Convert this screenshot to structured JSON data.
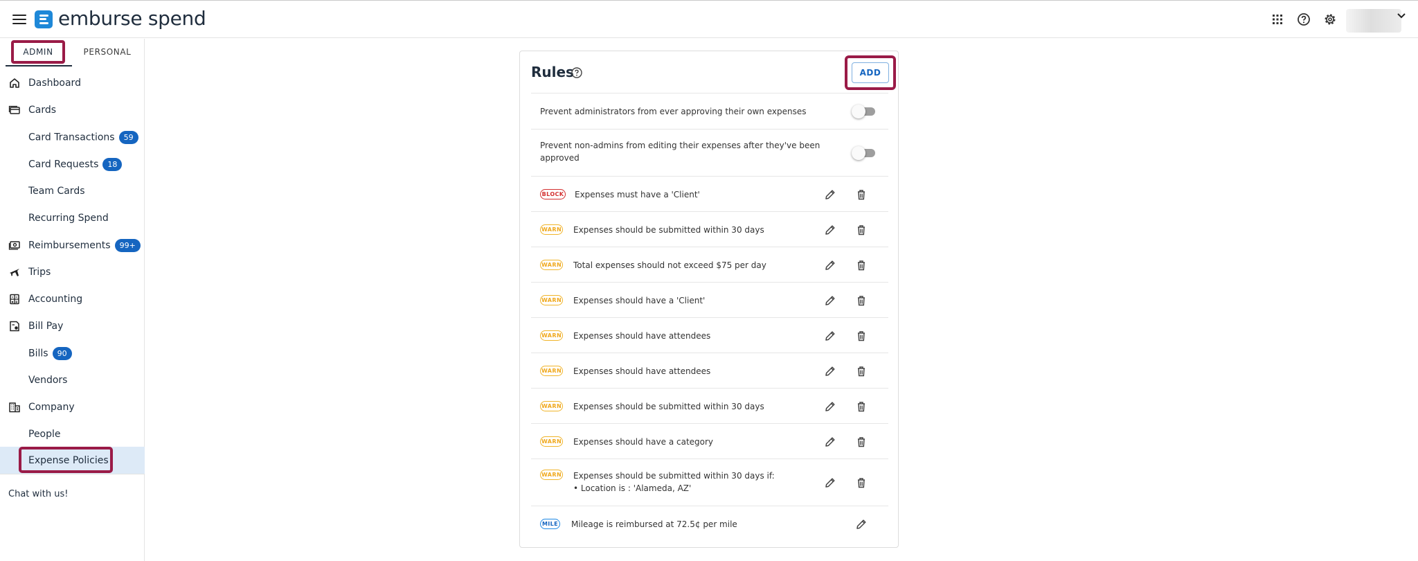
{
  "brand": {
    "name": "emburse spend",
    "color": "#1e88d8"
  },
  "highlight_color": "#9a1b47",
  "header": {
    "icons": [
      "apps-grid-icon",
      "help-circle-icon",
      "settings-gear-icon",
      "chevron-down-icon"
    ]
  },
  "sidebar": {
    "tabs": {
      "admin": "ADMIN",
      "personal": "PERSONAL"
    },
    "items": [
      {
        "label": "Dashboard",
        "icon": "home-icon"
      },
      {
        "label": "Cards",
        "icon": "cards-icon"
      },
      {
        "label": "Card Transactions",
        "badge": "59"
      },
      {
        "label": "Card Requests",
        "badge": "18"
      },
      {
        "label": "Team Cards"
      },
      {
        "label": "Recurring Spend"
      },
      {
        "label": "Reimbursements",
        "badge": "99+",
        "icon": "money-icon"
      },
      {
        "label": "Trips",
        "icon": "plane-icon"
      },
      {
        "label": "Accounting",
        "icon": "accounting-icon"
      },
      {
        "label": "Bill Pay",
        "icon": "bill-icon"
      },
      {
        "label": "Bills",
        "badge": "90"
      },
      {
        "label": "Vendors"
      },
      {
        "label": "Company",
        "icon": "building-icon"
      },
      {
        "label": "People"
      },
      {
        "label": "Expense Policies",
        "active": true
      }
    ],
    "chat": "Chat with us!"
  },
  "rules": {
    "title": "Rules",
    "add_label": "ADD",
    "toggles": [
      {
        "text": "Prevent administrators from ever approving their own expenses",
        "on": false
      },
      {
        "line1": "Prevent non-admins from editing their expenses after they've been",
        "line2": "approved",
        "on": false
      }
    ],
    "list": [
      {
        "tag": "BLOCK",
        "text": "Expenses must have a 'Client'"
      },
      {
        "tag": "WARN",
        "text": "Expenses should be submitted within 30 days"
      },
      {
        "tag": "WARN",
        "text": "Total expenses should not exceed $75 per day"
      },
      {
        "tag": "WARN",
        "text": "Expenses should have a 'Client'"
      },
      {
        "tag": "WARN",
        "text": "Expenses should have attendees"
      },
      {
        "tag": "WARN",
        "text": "Expenses should have attendees"
      },
      {
        "tag": "WARN",
        "text": "Expenses should be submitted within 30 days"
      },
      {
        "tag": "WARN",
        "text": "Expenses should have a category"
      },
      {
        "tag": "WARN",
        "line1": "Expenses should be submitted within 30 days if:",
        "line2": "• Location is : 'Alameda, AZ'"
      },
      {
        "tag": "MILE",
        "text": "Mileage is reimbursed at 72.5¢ per mile"
      }
    ]
  }
}
